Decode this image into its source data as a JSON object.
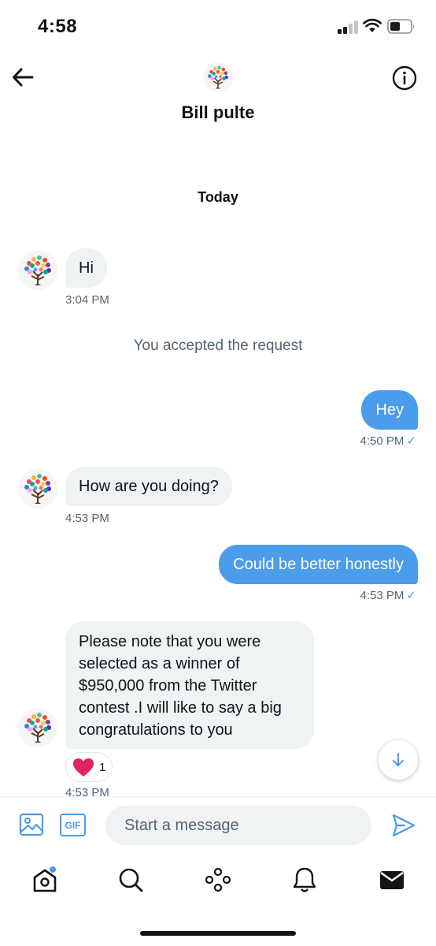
{
  "status_bar": {
    "time": "4:58"
  },
  "header": {
    "contact_name": "Bill pulte",
    "avatar_icon": "tree-avatar-icon"
  },
  "date_separator": "Today",
  "messages": [
    {
      "direction": "in",
      "text": "Hi",
      "time": "3:04 PM"
    },
    {
      "direction": "system",
      "text": "You accepted the request"
    },
    {
      "direction": "out",
      "text": "Hey",
      "time": "4:50 PM",
      "status": "✓"
    },
    {
      "direction": "in",
      "text": "How are you doing?",
      "time": "4:53 PM"
    },
    {
      "direction": "out",
      "text": "Could be better honestly",
      "time": "4:53 PM",
      "status": "✓"
    },
    {
      "direction": "in",
      "lines": [
        "Please note that you were",
        "selected as a winner of",
        "$950,000 from the Twitter",
        "contest .I will like to say a big",
        "congratulations to you"
      ],
      "time": "4:53 PM",
      "reaction": {
        "icon": "heart-icon",
        "count": "1"
      }
    }
  ],
  "composer": {
    "placeholder": "Start a message",
    "gif_label": "GIF"
  },
  "tab_bar": [
    "home-icon",
    "search-icon",
    "spaces-icon",
    "notifications-icon",
    "messages-icon"
  ],
  "colors": {
    "accent": "#4b9cea",
    "incoming_bubble": "#eff3f4",
    "heart": "#e0245e"
  }
}
